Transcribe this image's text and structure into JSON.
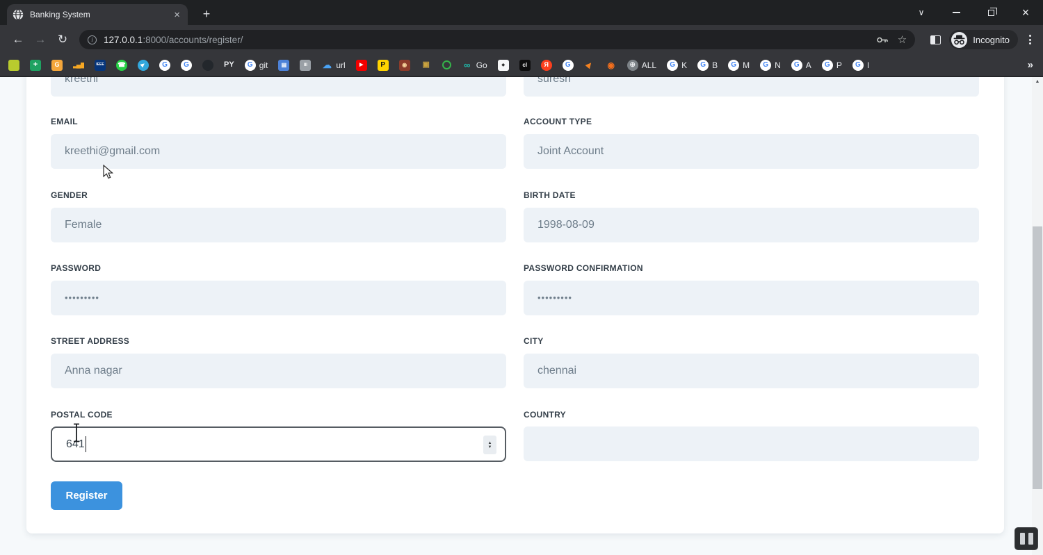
{
  "tab": {
    "title": "Banking System",
    "close_glyph": "×",
    "new_tab_glyph": "+"
  },
  "window_controls": {
    "chevron_glyph": "∨",
    "close_glyph": "×"
  },
  "toolbar": {
    "back_glyph": "←",
    "forward_glyph": "→",
    "reload_glyph": "↻",
    "info_glyph": "i",
    "star_glyph": "☆",
    "url": {
      "host": "127.0.0.1",
      "path": ":8000/accounts/register/"
    },
    "incognito_label": "Incognito"
  },
  "bookmarks_overflow_glyph": "»",
  "bookmarks": [
    {
      "name": "marker-bookmark",
      "shape": "sq",
      "bg": "#b9cb2e",
      "glyph": "",
      "fg": "#7a8a1e",
      "fs": 8
    },
    {
      "name": "sheets-bookmark",
      "shape": "sq",
      "bg": "#1fa262",
      "glyph": "+",
      "fg": "#ffffff",
      "fs": 11
    },
    {
      "name": "office-bookmark",
      "shape": "sq",
      "bg": "#f4a63b",
      "glyph": "G",
      "fg": "#ffffff",
      "fs": 9
    },
    {
      "name": "analytics-bookmark",
      "shape": "none",
      "glyph": "▂▄▆",
      "fg": "#f7a823",
      "fs": 9
    },
    {
      "name": "ieee-bookmark",
      "shape": "sq",
      "bg": "#06357a",
      "glyph": "IEEE",
      "fg": "#ffffff",
      "fs": 5
    },
    {
      "name": "whatsapp-bookmark",
      "shape": "ci",
      "bg": "#27d045",
      "glyph": "☎",
      "fg": "#ffffff",
      "fs": 9
    },
    {
      "name": "telegram-bookmark",
      "shape": "ci",
      "bg": "#32a8dd",
      "glyph": "▶",
      "fg": "#ffffff",
      "fs": 7,
      "rot": -40
    },
    {
      "name": "google-bookmark",
      "shape": "ci",
      "bg": "#ffffff",
      "glyph": "G",
      "fg": "#4285f4",
      "fs": 10
    },
    {
      "name": "google-bookmark",
      "shape": "ci",
      "bg": "#ffffff",
      "glyph": "G",
      "fg": "#4285f4",
      "fs": 10
    },
    {
      "name": "github-bookmark",
      "shape": "ci",
      "bg": "#23272c",
      "glyph": "",
      "fg": "#ffffff",
      "fs": 8
    },
    {
      "name": "py-bookmark",
      "shape": "text",
      "glyph": "PY",
      "fg": "#e8eaed",
      "fs": 11
    },
    {
      "name": "git-bookmark",
      "shape": "ci",
      "bg": "#ffffff",
      "glyph": "G",
      "fg": "#4285f4",
      "fs": 10,
      "label": "git"
    },
    {
      "name": "window-bookmark",
      "shape": "sq",
      "bg": "#4d82d8",
      "glyph": "▤",
      "fg": "#ffffff",
      "fs": 8
    },
    {
      "name": "bank-bookmark",
      "shape": "sq",
      "bg": "#9aa0a6",
      "glyph": "III",
      "fg": "#ffffff",
      "fs": 6
    },
    {
      "name": "url-bookmark",
      "shape": "none",
      "glyph": "☁",
      "fg": "#4aa3f5",
      "fs": 13,
      "label": "url"
    },
    {
      "name": "youtube-bookmark",
      "shape": "sq",
      "bg": "#f20000",
      "glyph": "▶",
      "fg": "#ffffff",
      "fs": 7
    },
    {
      "name": "p-bookmark",
      "shape": "sq",
      "bg": "#ffd400",
      "glyph": "P",
      "fg": "#111111",
      "fs": 10
    },
    {
      "name": "camera-bookmark",
      "shape": "sq",
      "bg": "#8c3b2a",
      "glyph": "◉",
      "fg": "#f5d29a",
      "fs": 8
    },
    {
      "name": "cart-bookmark",
      "shape": "none",
      "glyph": "▣",
      "fg": "#c9a23f",
      "fs": 11
    },
    {
      "name": "ring-bookmark",
      "shape": "ring",
      "ring": "#35b34a"
    },
    {
      "name": "godaddy-bookmark",
      "shape": "none",
      "glyph": "∞",
      "fg": "#1fc1b0",
      "fs": 13,
      "label": "Go"
    },
    {
      "name": "page-bird-bookmark",
      "shape": "sq",
      "bg": "#f5f6f7",
      "glyph": "◆",
      "fg": "#2b2b2b",
      "fs": 6
    },
    {
      "name": "cl-bookmark",
      "shape": "sq",
      "bg": "#0d0d0d",
      "glyph": "cl",
      "fg": "#ffffff",
      "fs": 8
    },
    {
      "name": "yandex-bookmark",
      "shape": "ci",
      "bg": "#fc3f1d",
      "glyph": "Я",
      "fg": "#ffffff",
      "fs": 9
    },
    {
      "name": "google-bookmark",
      "shape": "ci",
      "bg": "#ffffff",
      "glyph": "G",
      "fg": "#4285f4",
      "fs": 10
    },
    {
      "name": "bird-bookmark",
      "shape": "none",
      "glyph": "▶",
      "fg": "#f58220",
      "fs": 10,
      "rot": -50
    },
    {
      "name": "eye-bookmark",
      "shape": "none",
      "glyph": "◉",
      "fg": "#f56f1c",
      "fs": 12
    },
    {
      "name": "all-bookmark",
      "shape": "ci",
      "bg": "#7c8287",
      "glyph": "⊕",
      "fg": "#e8eaed",
      "fs": 10,
      "label": "ALL"
    },
    {
      "name": "google-k-bookmark",
      "shape": "ci",
      "bg": "#ffffff",
      "glyph": "G",
      "fg": "#4285f4",
      "fs": 10,
      "label": "K"
    },
    {
      "name": "google-b-bookmark",
      "shape": "ci",
      "bg": "#ffffff",
      "glyph": "G",
      "fg": "#4285f4",
      "fs": 10,
      "label": "B"
    },
    {
      "name": "google-m-bookmark",
      "shape": "ci",
      "bg": "#ffffff",
      "glyph": "G",
      "fg": "#4285f4",
      "fs": 10,
      "label": "M"
    },
    {
      "name": "google-n-bookmark",
      "shape": "ci",
      "bg": "#ffffff",
      "glyph": "G",
      "fg": "#4285f4",
      "fs": 10,
      "label": "N"
    },
    {
      "name": "google-a-bookmark",
      "shape": "ci",
      "bg": "#ffffff",
      "glyph": "G",
      "fg": "#4285f4",
      "fs": 10,
      "label": "A"
    },
    {
      "name": "google-p-bookmark",
      "shape": "ci",
      "bg": "#ffffff",
      "glyph": "G",
      "fg": "#4285f4",
      "fs": 10,
      "label": "P"
    },
    {
      "name": "google-i-bookmark",
      "shape": "ci",
      "bg": "#ffffff",
      "glyph": "G",
      "fg": "#4285f4",
      "fs": 10,
      "label": "I"
    }
  ],
  "form": {
    "first_name_partial": {
      "value": "kreethi"
    },
    "last_name_partial": {
      "value": "suresh"
    },
    "email": {
      "label": "EMAIL",
      "value": "kreethi@gmail.com"
    },
    "account_type": {
      "label": "ACCOUNT TYPE",
      "value": "Joint Account"
    },
    "gender": {
      "label": "GENDER",
      "value": "Female"
    },
    "birth_date": {
      "label": "BIRTH DATE",
      "value": "1998-08-09"
    },
    "password": {
      "label": "PASSWORD",
      "value": "•••••••••"
    },
    "password_confirmation": {
      "label": "PASSWORD CONFIRMATION",
      "value": "•••••••••"
    },
    "street_address": {
      "label": "STREET ADDRESS",
      "value": "Anna nagar"
    },
    "city": {
      "label": "CITY",
      "value": "chennai"
    },
    "postal_code": {
      "label": "POSTAL CODE",
      "value": "641"
    },
    "country": {
      "label": "COUNTRY",
      "value": ""
    },
    "register_label": "Register",
    "spinner_up_glyph": "▲",
    "spinner_down_glyph": "▼"
  },
  "scrollbar": {
    "up_glyph": "▲"
  },
  "colors": {
    "accent": "#3c92de",
    "field_bg": "#edf2f7",
    "chrome": "#35363a",
    "page_bg": "#f6f9fb",
    "label": "#333e48",
    "value": "#6e7d8a"
  }
}
